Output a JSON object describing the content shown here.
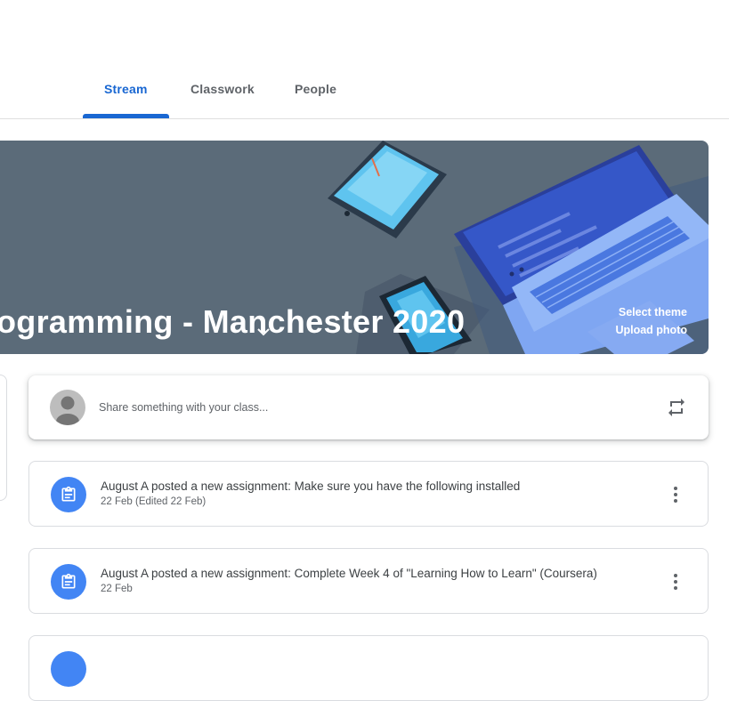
{
  "tabs": [
    {
      "label": "Stream",
      "active": true
    },
    {
      "label": "Classwork",
      "active": false
    },
    {
      "label": "People",
      "active": false
    }
  ],
  "banner": {
    "title": "ogramming - Manchester 2020",
    "select_theme": "Select theme",
    "upload_photo": "Upload photo",
    "background_color": "#5b6b79"
  },
  "share": {
    "placeholder": "Share something with your class..."
  },
  "posts": [
    {
      "title": "August A posted a new assignment: Make sure you have the following installed",
      "date": "22 Feb (Edited 22 Feb)",
      "icon": "assignment-icon"
    },
    {
      "title": "August A posted a new assignment: Complete Week 4 of \"Learning How to Learn\" (Coursera)",
      "date": "22 Feb",
      "icon": "assignment-icon"
    }
  ],
  "colors": {
    "accent": "#1967d2",
    "assignment_icon_bg": "#4285f4"
  }
}
